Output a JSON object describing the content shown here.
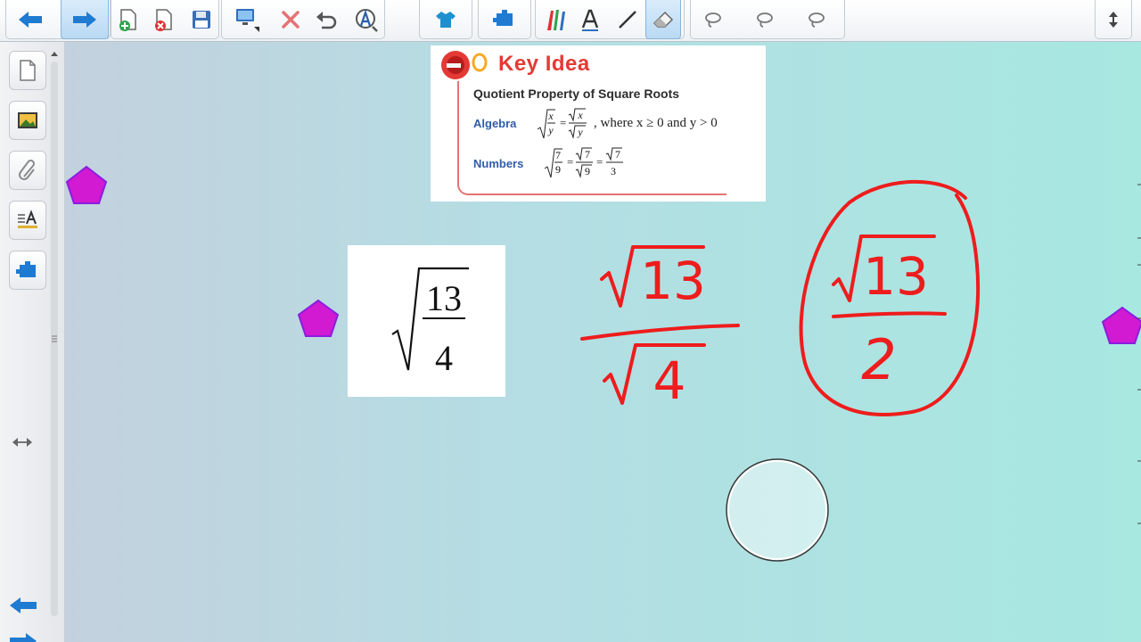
{
  "toolbar": {
    "buttons": [
      "back",
      "forward",
      "add-page",
      "delete-page",
      "save",
      "screen",
      "delete",
      "undo",
      "recognize",
      "shirt",
      "table",
      "pens",
      "text",
      "line",
      "eraser",
      "lasso-1",
      "lasso-2",
      "lasso-3",
      "expand"
    ]
  },
  "key_idea": {
    "title": "Key Idea",
    "subtitle": "Quotient Property of Square Roots",
    "algebra_label": "Algebra",
    "algebra_condition": ", where x ≥ 0 and y > 0",
    "numbers_label": "Numbers",
    "alg_x": "x",
    "alg_y": "y",
    "alg_eq": "=",
    "num_7": "7",
    "num_9": "9",
    "num_3": "3"
  },
  "card": {
    "numerator": "13",
    "denominator": "4"
  },
  "handwriting": {
    "step1_numerator": "13",
    "step1_denominator": "4",
    "step2_numerator": "13",
    "step2_denominator": "2"
  },
  "colors": {
    "ink": "#ee1c1c",
    "pentagon_fill": "#d11ad1",
    "pentagon_stroke": "#8a1de0",
    "accent_blue": "#1f7bd1"
  }
}
